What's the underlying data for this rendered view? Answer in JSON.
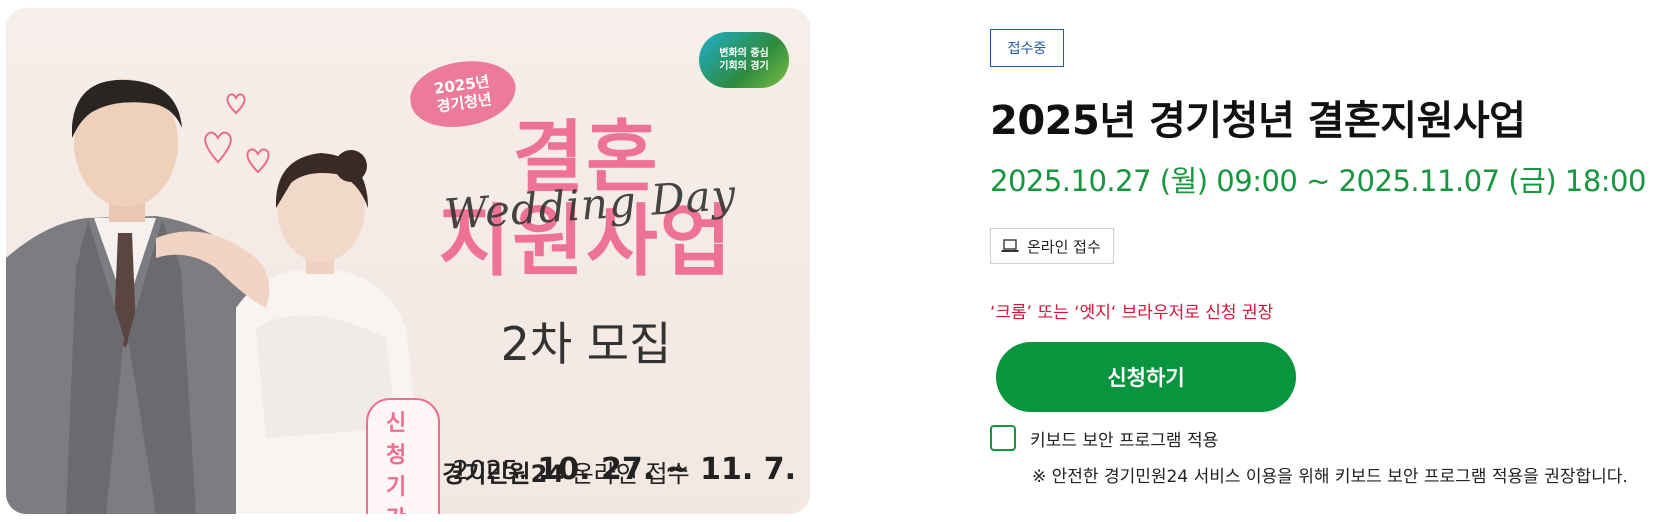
{
  "poster": {
    "logo_line1": "변화의 중심",
    "logo_line2": "기회의 경기",
    "year": "2025년",
    "program": "경기청년",
    "title_line1": "결혼",
    "title_line2": "지원사업",
    "script_text": "Wedding Day",
    "round": "2차 모집",
    "period_label": "신청기간",
    "period_year": "2025.",
    "period_dates": "10. 27. ~ 11. 7.",
    "online_bold": "경기민원24",
    "online_rest": "온라인 접수",
    "accent_color": "#ee7298"
  },
  "detail": {
    "status": "접수중",
    "title": "2025년 경기청년 결혼지원사업",
    "date_range": "2025.10.27 (월) 09:00 ~ 2025.11.07 (금) 18:00",
    "method_icon": "laptop-icon",
    "method": "온라인 접수",
    "browser_note": "‘크롬’ 또는 ‘엣지‘ 브라우저로 신청 권장",
    "apply_label": "신청하기",
    "keyboard_security_label": "키보드 보안 프로그램 적용",
    "keyboard_security_checked": false,
    "keyboard_security_note": "※ 안전한 경기민원24 서비스 이용을 위해 키보드 보안 프로그램 적용을 권장합니다.",
    "brand_green": "#07963d",
    "status_blue": "#1f5aa8",
    "warning_red": "#d4173a"
  }
}
